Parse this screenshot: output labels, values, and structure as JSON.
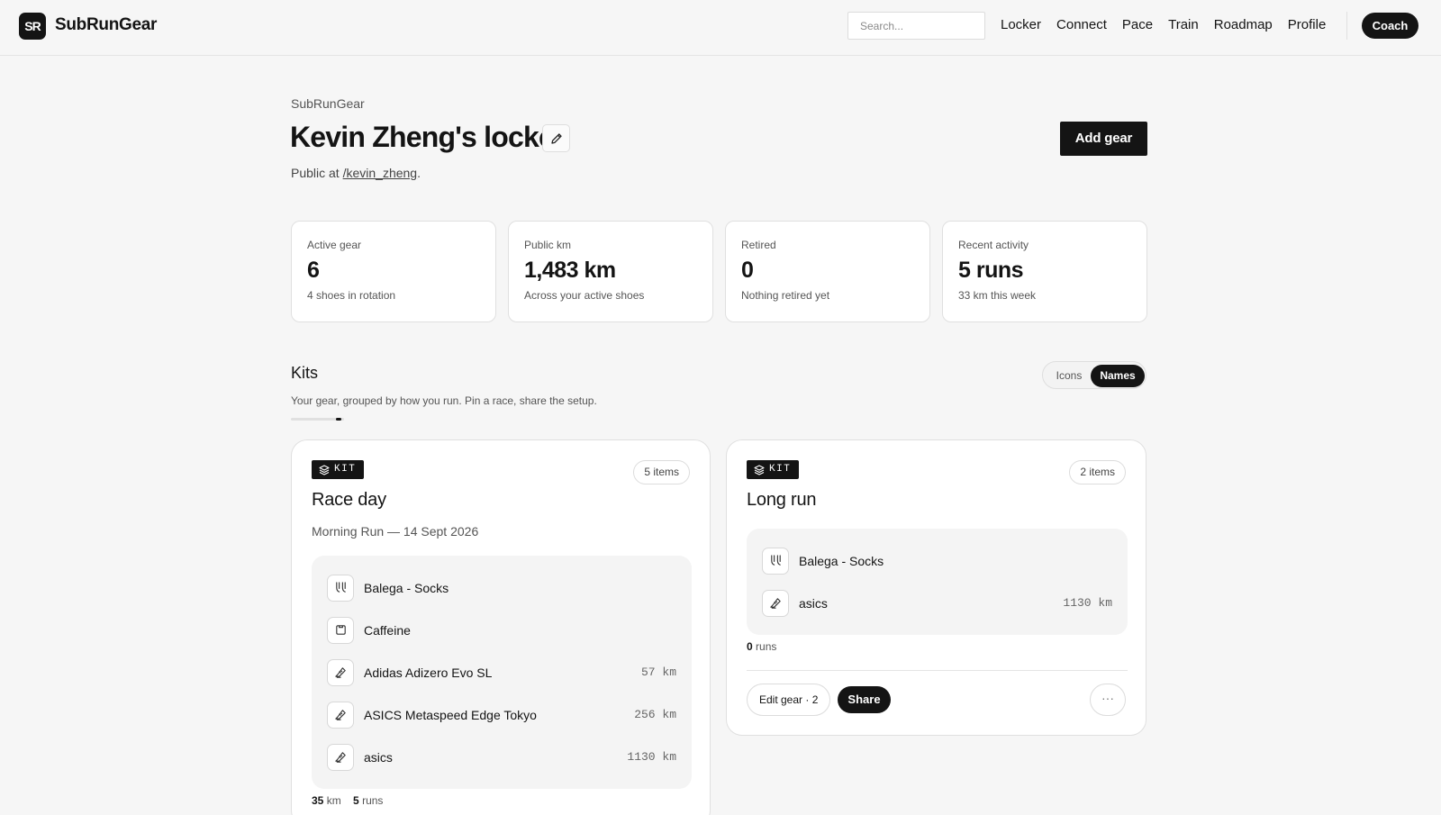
{
  "header": {
    "logo_text": "SR",
    "brand": "SubRunGear",
    "search_placeholder": "Search...",
    "nav": [
      "Locker",
      "Connect",
      "Pace",
      "Train",
      "Roadmap",
      "Profile"
    ],
    "coach": "Coach"
  },
  "page": {
    "breadcrumb": "SubRunGear",
    "title": "Kevin Zheng's locker",
    "public_prefix": "Public at ",
    "public_link": "/kevin_zheng",
    "public_suffix": ".",
    "add_gear": "Add gear"
  },
  "stats": [
    {
      "label": "Active gear",
      "value": "6",
      "sub": "4 shoes in rotation"
    },
    {
      "label": "Public km",
      "value": "1,483 km",
      "sub": "Across your active shoes"
    },
    {
      "label": "Retired",
      "value": "0",
      "sub": "Nothing retired yet"
    },
    {
      "label": "Recent activity",
      "value": "5 runs",
      "sub": "33 km this week"
    }
  ],
  "kits": {
    "heading": "Kits",
    "subheading": "Your gear, grouped by how you run. Pin a race, share the setup.",
    "toggle": {
      "icons": "Icons",
      "names": "Names",
      "selected": "Names"
    },
    "scroll_progress": 0.95,
    "cards": [
      {
        "badge": "KIT",
        "count": "5 items",
        "title": "Race day",
        "meta": "Morning Run — 14 Sept 2026",
        "items": [
          {
            "icon": "socks-icon",
            "name": "Balega - Socks",
            "km": ""
          },
          {
            "icon": "caffeine-icon",
            "name": "Caffeine",
            "km": ""
          },
          {
            "icon": "shoe-icon",
            "name": "Adidas Adizero Evo SL",
            "km": "57 km"
          },
          {
            "icon": "shoe-icon",
            "name": "ASICS Metaspeed Edge Tokyo",
            "km": "256 km"
          },
          {
            "icon": "shoe-icon",
            "name": "asics",
            "km": "1130 km"
          }
        ],
        "km_total": "35",
        "km_unit": "km",
        "runs": "5",
        "runs_unit": "runs"
      },
      {
        "badge": "KIT",
        "count": "2 items",
        "title": "Long run",
        "items": [
          {
            "icon": "socks-icon",
            "name": "Balega - Socks",
            "km": ""
          },
          {
            "icon": "shoe-icon",
            "name": "asics",
            "km": "1130 km"
          }
        ],
        "runs": "0",
        "runs_unit": "runs",
        "edit_label": "Edit gear · 2",
        "share_label": "Share",
        "more_label": "···"
      }
    ]
  }
}
